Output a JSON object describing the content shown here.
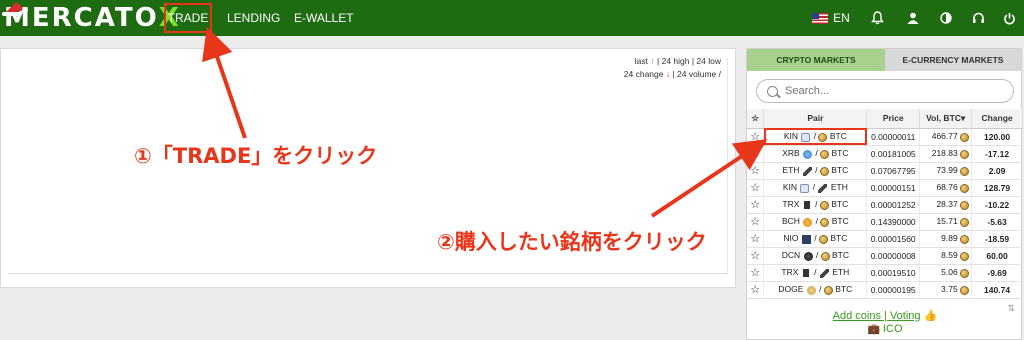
{
  "brand": {
    "logo_text": "MERCATO",
    "logo_x": "X"
  },
  "nav": {
    "trade": "TRADE",
    "lending": "LENDING",
    "ewallet": "E-WALLET",
    "language": "EN"
  },
  "chart_stats": {
    "line1": [
      "last",
      "| 24 high | 24 low"
    ],
    "line2": [
      "24 change",
      "| 24 volume /"
    ]
  },
  "markets": {
    "tab_crypto": "CRYPTO MARKETS",
    "tab_ecurrency": "E-CURRENCY MARKETS",
    "search_placeholder": "Search...",
    "headers": {
      "pair": "Pair",
      "price": "Price",
      "volume": "Vol, BTC▾",
      "change": "Change"
    },
    "rows": [
      {
        "base": "KIN",
        "quote": "BTC",
        "price": "0.00000011",
        "volume": "466.77",
        "change": "120.00",
        "dir": "pos"
      },
      {
        "base": "XRB",
        "quote": "BTC",
        "price": "0.00181005",
        "volume": "218.83",
        "change": "-17.12",
        "dir": "neg"
      },
      {
        "base": "ETH",
        "quote": "BTC",
        "price": "0.07067795",
        "volume": "73.99",
        "change": "2.09",
        "dir": "pos"
      },
      {
        "base": "KIN",
        "quote": "ETH",
        "price": "0.00000151",
        "volume": "68.76",
        "change": "128.79",
        "dir": "pos"
      },
      {
        "base": "TRX",
        "quote": "BTC",
        "price": "0.00001252",
        "volume": "28.37",
        "change": "-10.22",
        "dir": "neg"
      },
      {
        "base": "BCH",
        "quote": "BTC",
        "price": "0.14390000",
        "volume": "15.71",
        "change": "-5.63",
        "dir": "neg"
      },
      {
        "base": "NIO",
        "quote": "BTC",
        "price": "0.00001560",
        "volume": "9.89",
        "change": "-18.59",
        "dir": "neg"
      },
      {
        "base": "DCN",
        "quote": "BTC",
        "price": "0.00000008",
        "volume": "8.59",
        "change": "60.00",
        "dir": "pos"
      },
      {
        "base": "TRX",
        "quote": "ETH",
        "price": "0.00019510",
        "volume": "5.06",
        "change": "-9.69",
        "dir": "neg"
      },
      {
        "base": "DOGE",
        "quote": "BTC",
        "price": "0.00000195",
        "volume": "3.75",
        "change": "140.74",
        "dir": "pos"
      }
    ],
    "add_coins": "Add coins | Voting",
    "ico": "ICO"
  },
  "annotations": {
    "step1": "①「TRADE」をクリック",
    "step2": "②購入したい銘柄をクリック"
  },
  "colors": {
    "nav_bg": "#1f6b12",
    "accent_red": "#e8361a",
    "positive": "#3a9a1c",
    "negative": "#c62828"
  }
}
